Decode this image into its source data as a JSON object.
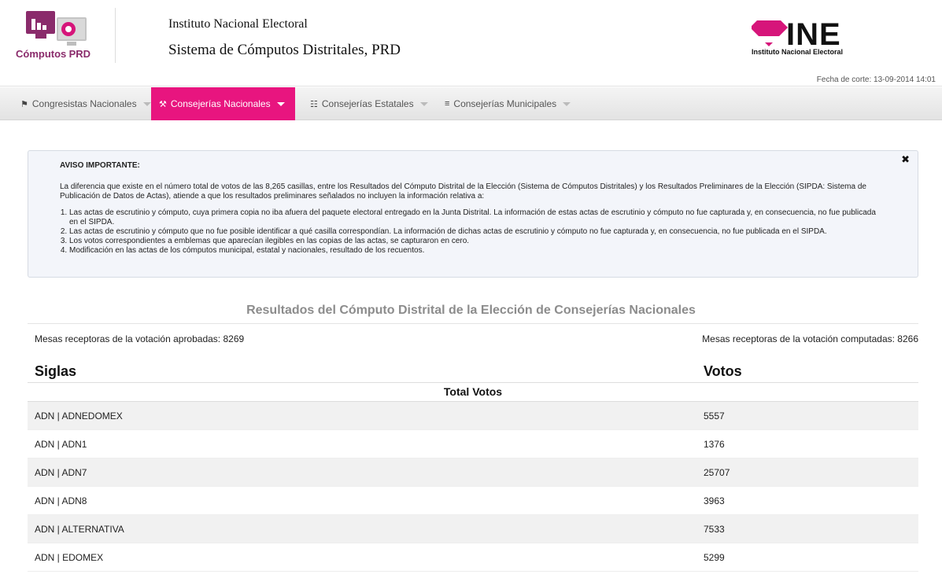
{
  "header": {
    "logo_text": "Cómputos",
    "logo_text_bold": "PRD",
    "institute": "Instituto Nacional Electoral",
    "system_title": "Sistema de Cómputos Distritales, PRD",
    "ine_logo_text": "INE",
    "ine_logo_sub": "Instituto Nacional Electoral",
    "fecha_corte": "Fecha de corte: 13-09-2014 14:01"
  },
  "nav": {
    "items": [
      {
        "label": "Congresistas Nacionales",
        "icon": "flag-icon",
        "active": false
      },
      {
        "label": "Consejerías Nacionales",
        "icon": "gavel-icon",
        "active": true
      },
      {
        "label": "Consejerías Estatales",
        "icon": "list-icon",
        "active": false
      },
      {
        "label": "Consejerías Municipales",
        "icon": "menu-icon",
        "active": false
      }
    ]
  },
  "notice": {
    "title": "AVISO IMPORTANTE:",
    "text": "La diferencia que existe en el número total de votos de las 8,265 casillas, entre los Resultados del Cómputo Distrital de la Elección (Sistema de Cómputos Distritales) y los Resultados Preliminares de la Elección (SIPDA: Sistema de Publicación de Datos de Actas), atiende a que los resultados preliminares señalados no incluyen la información relativa a:",
    "items": [
      "Las actas de escrutinio y cómputo, cuya primera copia no iba afuera del paquete electoral entregado en la Junta Distrital. La información de estas actas de escrutinio y cómputo no fue capturada y, en consecuencia, no fue publicada en el SIPDA.",
      "Las actas de escrutinio y cómputo que no fue posible identificar a qué casilla correspondían. La información de dichas actas de escrutinio y cómputo no fue capturada y, en consecuencia, no fue publicada en el SIPDA.",
      "Los votos correspondientes a emblemas que aparecían ilegibles en las copias de las actas, se capturaron en cero.",
      "Modificación en las actas de los cómputos municipal, estatal y nacionales, resultado de los recuentos."
    ]
  },
  "results": {
    "title": "Resultados del Cómputo Distrital de la Elección de Consejerías Nacionales",
    "mesas_aprobadas": "Mesas receptoras de la votación aprobadas: 8269",
    "mesas_computadas": "Mesas receptoras de la votación computadas: 8266",
    "col_siglas": "Siglas",
    "col_votos": "Votos",
    "total_label": "Total Votos",
    "rows": [
      {
        "siglas": "ADN | ADNEDOMEX",
        "votos": "5557"
      },
      {
        "siglas": "ADN | ADN1",
        "votos": "1376"
      },
      {
        "siglas": "ADN | ADN7",
        "votos": "25707"
      },
      {
        "siglas": "ADN | ADN8",
        "votos": "3963"
      },
      {
        "siglas": "ADN | ALTERNATIVA",
        "votos": "7533"
      },
      {
        "siglas": "ADN | EDOMEX",
        "votos": "5299"
      }
    ]
  }
}
